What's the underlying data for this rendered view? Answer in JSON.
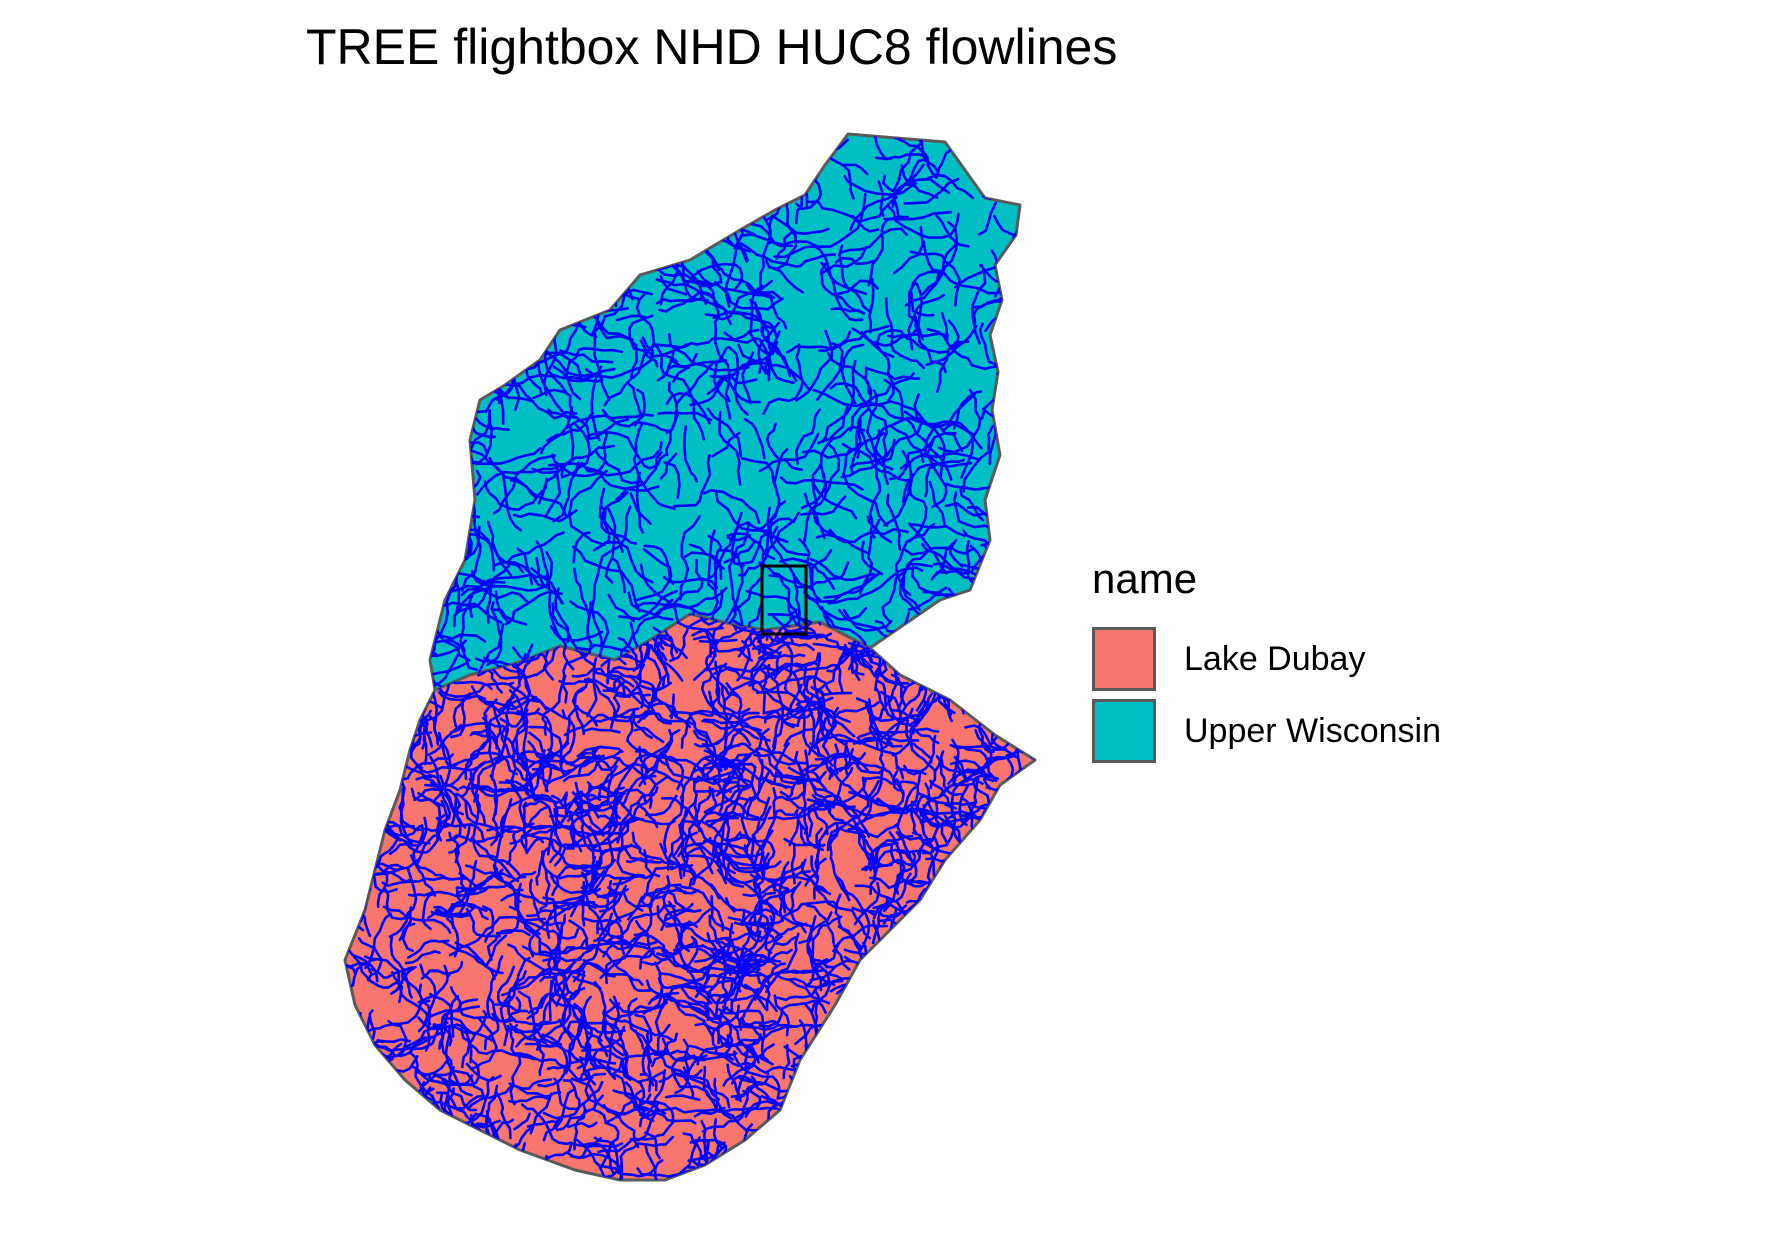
{
  "title": "TREE flightbox NHD HUC8 flowlines",
  "legend": {
    "title": "name",
    "items": [
      {
        "label": "Lake Dubay",
        "color": "#F8766D"
      },
      {
        "label": "Upper Wisconsin",
        "color": "#00BFC4"
      }
    ]
  },
  "styles": {
    "flowline_color": "#0000FF",
    "boundary_color": "#5a5a5a",
    "flightbox_color": "#000000"
  }
}
